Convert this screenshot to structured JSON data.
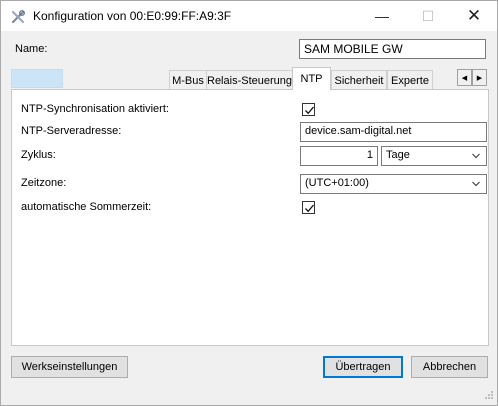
{
  "window": {
    "title": "Konfiguration von 00:E0:99:FF:A9:3F",
    "controls": {
      "minimize": "—",
      "maximize": "☐",
      "close": "✕"
    }
  },
  "name": {
    "label": "Name:",
    "value": "SAM MOBILE GW"
  },
  "tabs": {
    "items": [
      "M-Bus",
      "Relais-Steuerung",
      "NTP",
      "Sicherheit",
      "Experte"
    ],
    "active": "NTP",
    "scroll_left": "◀",
    "scroll_right": "▶"
  },
  "ntp": {
    "sync": {
      "label": "NTP-Synchronisation aktiviert:",
      "checked": true
    },
    "server": {
      "label": "NTP-Serveradresse:",
      "value": "device.sam-digital.net"
    },
    "cycle": {
      "label": "Zyklus:",
      "value": "1",
      "unit": "Tage"
    },
    "timezone": {
      "label": "Zeitzone:",
      "value": "(UTC+01:00)"
    },
    "dst": {
      "label": "automatische Sommerzeit:",
      "checked": true
    }
  },
  "buttons": {
    "factory": "Werkseinstellungen",
    "apply": "Übertragen",
    "cancel": "Abbrechen"
  },
  "icons": {
    "app": "tools-icon",
    "checkmark": "checkmark-icon",
    "dropdown": "chevron-down-icon",
    "grip": "resize-grip-icon"
  },
  "colors": {
    "window_bg": "#f0f0f0",
    "accent": "#0078d7",
    "selected_tab_highlight": "#cce4f7"
  }
}
